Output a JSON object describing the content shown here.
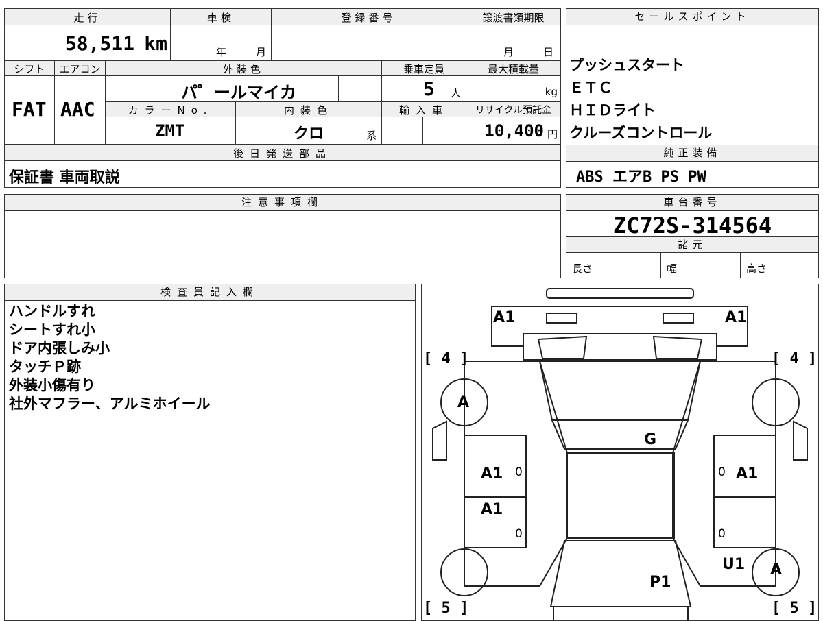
{
  "top_table": {
    "mileage_label": "走行",
    "mileage_value": "58,511",
    "mileage_unit": "km",
    "shaken_label": "車検",
    "shaken_year": "年",
    "shaken_month": "月",
    "registration_label": "登録番号",
    "transfer_deadline_label": "譲渡書類期限",
    "transfer_month": "月",
    "transfer_day": "日",
    "shift_label": "シフト",
    "shift_value": "FAT",
    "aircon_label": "エアコン",
    "aircon_value": "AAC",
    "exterior_color_label": "外装色",
    "exterior_color_value": "パ゜ールマイカ",
    "capacity_label": "乗車定員",
    "capacity_value": "5",
    "capacity_unit": "人",
    "max_load_label": "最大積載量",
    "max_load_unit": "kg",
    "color_no_label": "カラーNo.",
    "color_no_value": "ZMT",
    "interior_color_label": "内装色",
    "interior_color_value": "クロ",
    "interior_color_suffix": "系",
    "import_label": "輸入車",
    "recycle_label": "リサイクル預託金",
    "recycle_value": "10,400",
    "recycle_unit": "円",
    "later_parts_label": "後日発送部品",
    "later_parts_value": "保証書 車両取説"
  },
  "sales_points": {
    "label": "セールスポイント",
    "items": [
      "プッシュスタート",
      "ＥＴＣ",
      "ＨＩＤライト",
      "クルーズコントロール"
    ]
  },
  "standard_equipment": {
    "label": "純正装備",
    "value": "ABS エアB PS PW"
  },
  "notes": {
    "label": "注意事項欄"
  },
  "chassis": {
    "label": "車台番号",
    "value": "ZC72S-314564",
    "specs_label": "諸元",
    "length_label": "長さ",
    "width_label": "幅",
    "height_label": "高さ"
  },
  "inspector": {
    "label": "検査員記入欄",
    "lines": [
      "ハンドルすれ",
      "シートすれ小",
      "ドア内張しみ小",
      "タッチＰ跡",
      "外装小傷有り",
      "社外マフラー、アルミホイール"
    ]
  },
  "diagram": {
    "marks": {
      "front_left": "A1",
      "front_right": "A1",
      "tire_front_left": "[ 4 ]",
      "tire_front_right": "[ 4 ]",
      "wheel_front_left": "A",
      "windshield": "G",
      "door_fl": "A1",
      "door_fl_num": "0",
      "door_fr_num": "0",
      "door_fr": "A1",
      "door_rl": "A1",
      "door_rl_num": "0",
      "door_rr_num": "0",
      "rear_right": "U1",
      "wheel_rear_right": "A",
      "rear_body": "P1",
      "tire_rear_left": "[ 5 ]",
      "tire_rear_right": "[ 5 ]"
    }
  }
}
